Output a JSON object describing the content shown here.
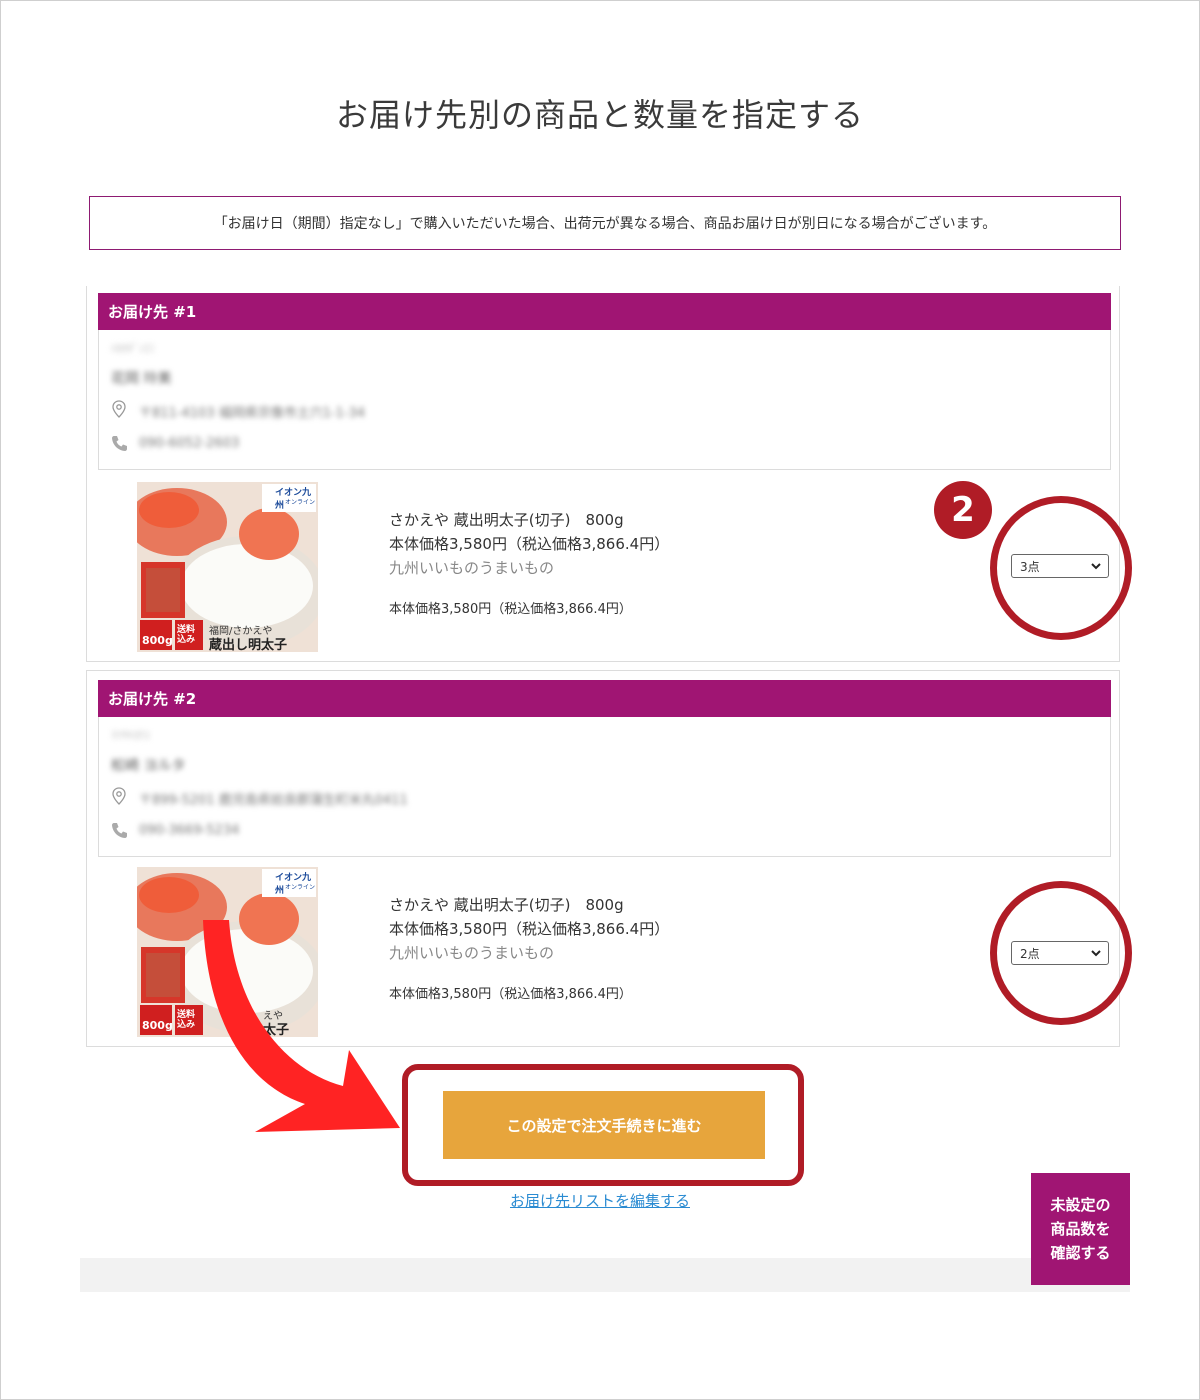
{
  "page_title": "お届け先別の商品と数量を指定する",
  "notice_text": "「お届け日（期間）指定なし」で購入いただいた場合、出荷元が異なる場合、商品お届け日が別日になる場合がございます。",
  "destinations": [
    {
      "header": "お届け先 #1",
      "kana": "ﾊｶﾀﾀﾞﾝｴﾐ",
      "name": "花岡 玲美",
      "address": "〒811-4103 福岡県宗像市土穴1-1-34",
      "phone": "090-6052-2603",
      "product": {
        "name": "さかえや 蔵出明太子(切子)　800g",
        "price": "本体価格3,580円（税込価格3,866.4円）",
        "shop": "九州いいものうまいもの",
        "subtotal": "本体価格3,580円（税込価格3,866.4円）",
        "image_brand": "イオン九州",
        "image_brand_sub": "オンライン",
        "image_caption": "福岡/さかえや",
        "image_title": "蔵出し明太子",
        "image_weight": "800g",
        "image_ship": "送料込み"
      },
      "quantity": "3点"
    },
    {
      "header": "お届け先 #2",
      "kana": "ﾏﾂｻｷﾖｳｺ",
      "name": "松崎 ヨルタ",
      "address": "〒899-5201 鹿児島県姶良郡蒲生町米丸0411",
      "phone": "090-3669-5234",
      "product": {
        "name": "さかえや 蔵出明太子(切子)　800g",
        "price": "本体価格3,580円（税込価格3,866.4円）",
        "shop": "九州いいものうまいもの",
        "subtotal": "本体価格3,580円（税込価格3,866.4円）",
        "image_brand": "イオン九州",
        "image_brand_sub": "オンライン",
        "image_caption": "えや",
        "image_title": "太子",
        "image_weight": "800g",
        "image_ship": "送料込み"
      },
      "quantity": "2点"
    }
  ],
  "step_number": "2",
  "proceed_button": "この設定で注文手続きに進む",
  "edit_link": "お届け先リストを編集する",
  "side_button": "未設定の\n商品数を\n確認する",
  "colors": {
    "brand_purple": "#a01573",
    "proceed_orange": "#e7a53c",
    "annotation_red": "#b01c26",
    "link_blue": "#2a8bd2"
  }
}
